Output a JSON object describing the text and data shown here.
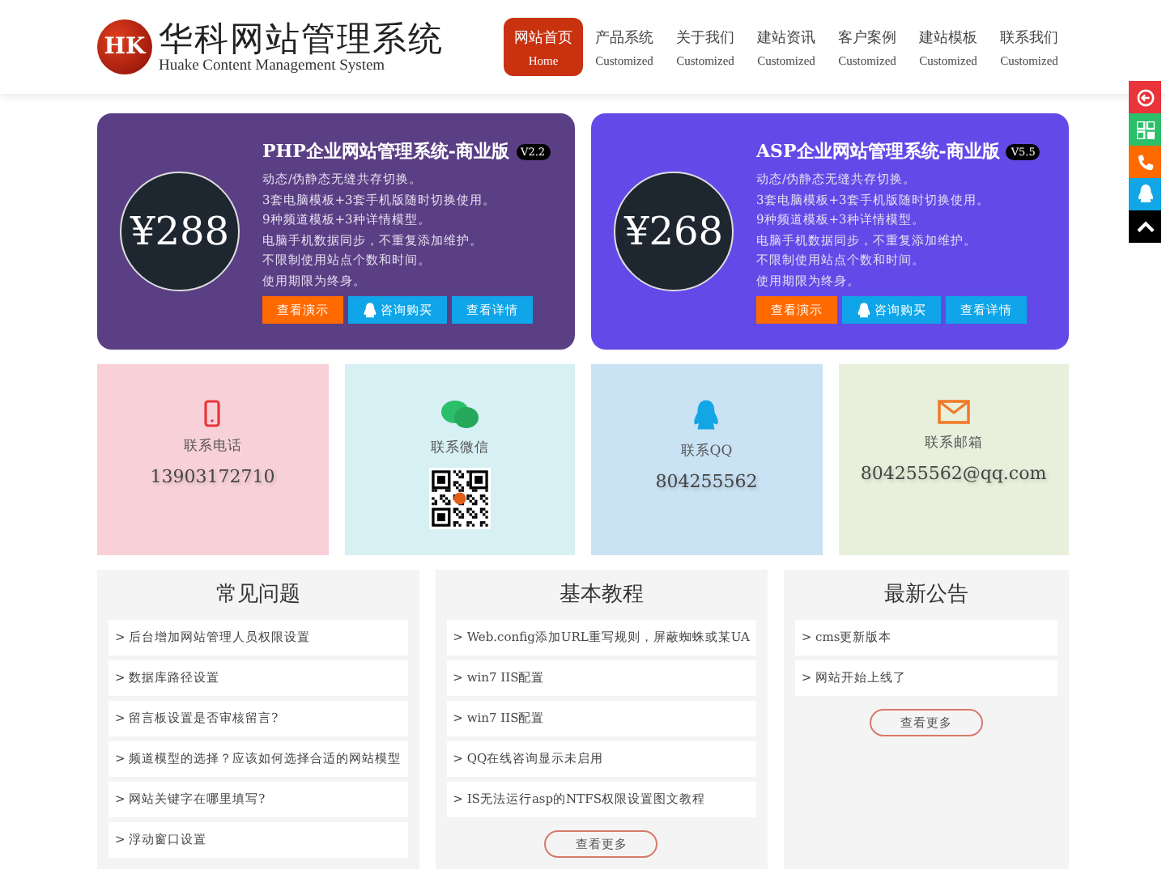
{
  "header": {
    "logo_text": "HK",
    "title": "华科网站管理系统",
    "subtitle": "Huake Content Management System",
    "nav": [
      {
        "label": "网站首页",
        "sublabel": "Home",
        "selected": true
      },
      {
        "label": "产品系统",
        "sublabel": "Customized",
        "selected": false
      },
      {
        "label": "关于我们",
        "sublabel": "Customized",
        "selected": false
      },
      {
        "label": "建站资讯",
        "sublabel": "Customized",
        "selected": false
      },
      {
        "label": "客户案例",
        "sublabel": "Customized",
        "selected": false
      },
      {
        "label": "建站模板",
        "sublabel": "Customized",
        "selected": false
      },
      {
        "label": "联系我们",
        "sublabel": "Customized",
        "selected": false
      }
    ]
  },
  "products": [
    {
      "title": "PHP企业网站管理系统-商业版",
      "version": "V2.2",
      "price": "¥288",
      "color": "#5b3f84",
      "features": [
        "动态/伪静态无缝共存切换。",
        "3套电脑模板+3套手机版随时切换使用。",
        "9种频道模板+3种详情模型。",
        "电脑手机数据同步，不重复添加维护。",
        "不限制使用站点个数和时间。",
        "使用期限为终身。"
      ],
      "buttons": [
        {
          "label": "查看演示",
          "kind": "demo"
        },
        {
          "label": "咨询购买",
          "kind": "consult"
        },
        {
          "label": "查看详情",
          "kind": "detail"
        }
      ]
    },
    {
      "title": "ASP企业网站管理系统-商业版",
      "version": "V5.5",
      "price": "¥268",
      "color": "#634ae8",
      "features": [
        "动态/伪静态无缝共存切换。",
        "3套电脑模板+3套手机版随时切换使用。",
        "9种频道模板+3种详情模型。",
        "电脑手机数据同步，不重复添加维护。",
        "不限制使用站点个数和时间。",
        "使用期限为终身。"
      ],
      "buttons": [
        {
          "label": "查看演示",
          "kind": "demo"
        },
        {
          "label": "咨询购买",
          "kind": "consult"
        },
        {
          "label": "查看详情",
          "kind": "detail"
        }
      ]
    }
  ],
  "contacts": [
    {
      "kind": "phone",
      "label": "联系电话",
      "value": "13903172710",
      "color": "#f8d1d8"
    },
    {
      "kind": "wechat",
      "label": "联系微信",
      "color": "#d6f0f3"
    },
    {
      "kind": "qq",
      "label": "联系QQ",
      "value": "804255562",
      "color": "#c9e2f4"
    },
    {
      "kind": "email",
      "label": "联系邮箱",
      "value": "804255562@qq.com",
      "color": "#e8f0dc"
    }
  ],
  "panels": [
    {
      "title": "常见问题",
      "items": [
        "> 后台增加网站管理人员权限设置",
        "> 数据库路径设置",
        "> 留言板设置是否审核留言?",
        "> 频道模型的选择？应该如何选择合适的网站模型",
        "> 网站关键字在哪里填写?",
        "> 浮动窗口设置"
      ]
    },
    {
      "title": "基本教程",
      "items": [
        "> Web.config添加URL重写规则，屏蔽蜘蛛或某UA",
        "> win7 IIS配置",
        "> win7 IIS配置",
        "> QQ在线咨询显示未启用",
        "> IS无法运行asp的NTFS权限设置图文教程"
      ],
      "more": "查看更多"
    },
    {
      "title": "最新公告",
      "items": [
        "> cms更新版本",
        "> 网站开始上线了"
      ],
      "more": "查看更多"
    }
  ]
}
